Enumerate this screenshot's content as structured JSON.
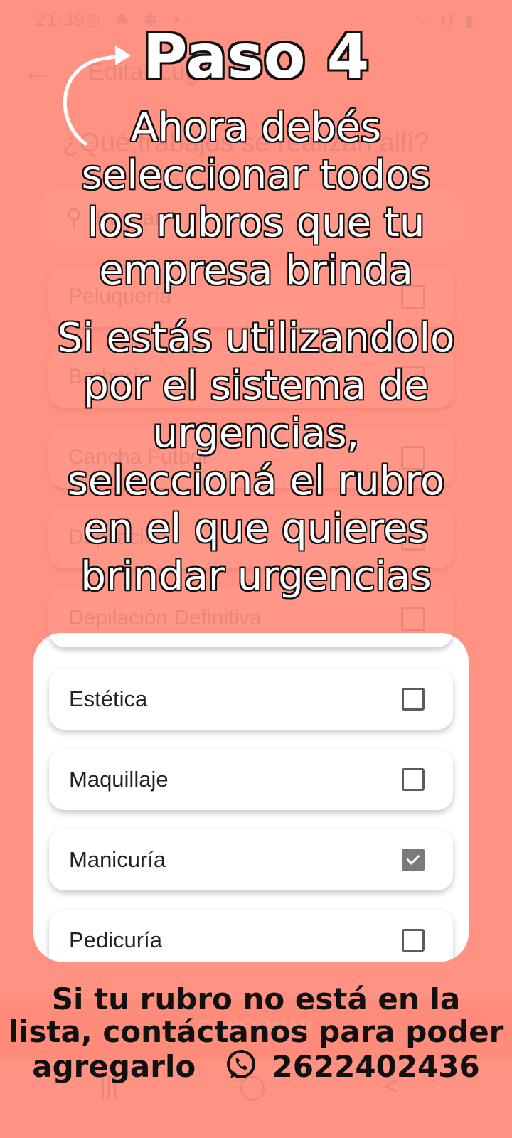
{
  "status_bar": {
    "time": "21:39",
    "left_icons": "◎ ♣ ✽ •",
    "right_icons": "⌔ ıl ▮"
  },
  "app_bar": {
    "back_icon": "arrow-back-icon",
    "title": "Editar Lugar"
  },
  "question": "¿Qué trabajos se realizan allí?",
  "search": {
    "icon": "search-icon",
    "placeholder": "Buscar"
  },
  "background_items": [
    {
      "label": "Peluquería"
    },
    {
      "label": "Barbería"
    },
    {
      "label": "Cancha Futbol"
    },
    {
      "label": "Depilación"
    },
    {
      "label": "Depilación Definitiva"
    }
  ],
  "card_items": [
    {
      "label": "Estética",
      "checked": false
    },
    {
      "label": "Maquillaje",
      "checked": false
    },
    {
      "label": "Manicuría",
      "checked": true
    },
    {
      "label": "Pedicuría",
      "checked": false
    }
  ],
  "confirm_label": "CONFIRMAR",
  "nav": {
    "recents": "|||",
    "home": "◯",
    "back": "<"
  },
  "overlay": {
    "title": "Paso 4",
    "instruction_1_lines": [
      "Ahora debés",
      "seleccionar todos",
      "los rubros que tu",
      "empresa brinda"
    ],
    "instruction_2_lines": [
      "Si estás utilizandolo",
      "por el sistema de",
      "urgencias,",
      "seleccioná el rubro",
      "en el que quieres",
      "brindar urgencias"
    ],
    "footer_line1": "Si tu rubro no está en la",
    "footer_line2": "lista, contáctanos para poder",
    "footer_line3": "agregarlo",
    "phone": "2622402436"
  },
  "colors": {
    "background": "#ff9283",
    "card": "#ffffff",
    "text_dark": "#111111"
  }
}
